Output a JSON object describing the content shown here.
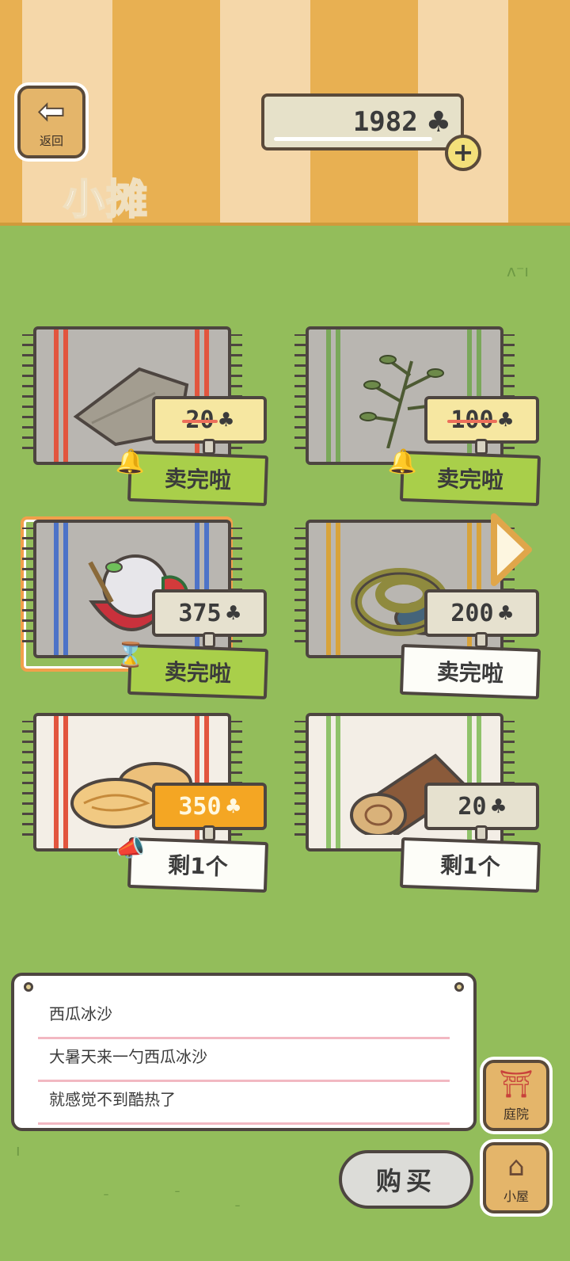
{
  "header": {
    "back_label": "返回",
    "title": "小摊",
    "coins": "1982",
    "coin_icon": "clover-icon"
  },
  "items": [
    {
      "name": "furoshiki",
      "price": "20",
      "price_struck": true,
      "status": "卖完啦",
      "tag_style": "green",
      "badge": "bell-icon"
    },
    {
      "name": "herb",
      "price": "100",
      "price_struck": true,
      "status": "卖完啦",
      "tag_style": "green",
      "badge": "bell-icon"
    },
    {
      "name": "watermelon-shaved-ice",
      "price": "375",
      "price_struck": false,
      "status": "卖完啦",
      "tag_style": "green",
      "badge": "hourglass-icon",
      "selected": true
    },
    {
      "name": "rope",
      "price": "200",
      "price_struck": false,
      "status": "卖完啦",
      "tag_style": "white"
    },
    {
      "name": "pastry",
      "price": "350",
      "price_struck": false,
      "status": "剩1个",
      "tag_style": "white",
      "badge": "megaphone-icon",
      "price_highlight": true
    },
    {
      "name": "log",
      "price": "20",
      "price_struck": false,
      "status": "剩1个",
      "tag_style": "white"
    }
  ],
  "description": {
    "line1": "西瓜冰沙",
    "line2": "大暑天来一勺西瓜冰沙",
    "line3": "就感觉不到酷热了"
  },
  "nav": {
    "yard_label": "庭院",
    "house_label": "小屋",
    "buy_label": "购买"
  },
  "colors": {
    "grass": "#93bd5b",
    "stripe_dark": "#e8b052",
    "stripe_light": "#f5d7a9",
    "tag_green": "#a9cf4a",
    "price_yellow": "#f6e7a1",
    "price_orange": "#f4a623",
    "selection": "#f1a04b"
  }
}
